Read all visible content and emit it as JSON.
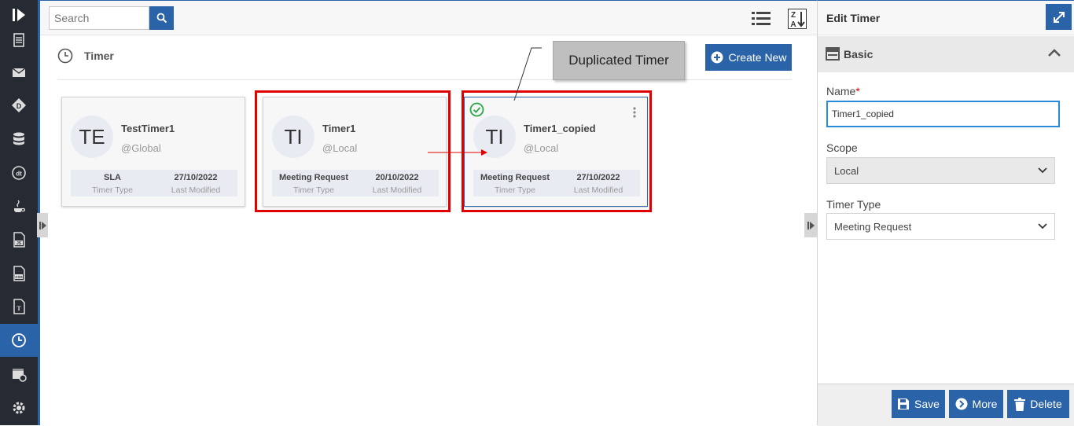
{
  "search": {
    "placeholder": "Search"
  },
  "page": {
    "title": "Timer",
    "create_label": "Create New"
  },
  "callout": {
    "text": "Duplicated Timer"
  },
  "cards": [
    {
      "initials": "TE",
      "name": "TestTimer1",
      "scope": "@Global",
      "timer_type": "SLA",
      "timer_type_label": "Timer Type",
      "modified": "27/10/2022",
      "modified_label": "Last Modified"
    },
    {
      "initials": "TI",
      "name": "Timer1",
      "scope": "@Local",
      "timer_type": "Meeting Request",
      "timer_type_label": "Timer Type",
      "modified": "20/10/2022",
      "modified_label": "Last Modified"
    },
    {
      "initials": "TI",
      "name": "Timer1_copied",
      "scope": "@Local",
      "timer_type": "Meeting Request",
      "timer_type_label": "Timer Type",
      "modified": "27/10/2022",
      "modified_label": "Last Modified"
    }
  ],
  "panel": {
    "title": "Edit Timer",
    "section": "Basic",
    "name_label": "Name",
    "required_mark": "*",
    "name_value": "Timer1_copied",
    "scope_label": "Scope",
    "scope_value": "Local",
    "type_label": "Timer Type",
    "type_value": "Meeting Request",
    "save_label": "Save",
    "more_label": "More",
    "delete_label": "Delete"
  },
  "colors": {
    "accent": "#2a63a8",
    "highlight": "#e00000",
    "success": "#28a745"
  }
}
